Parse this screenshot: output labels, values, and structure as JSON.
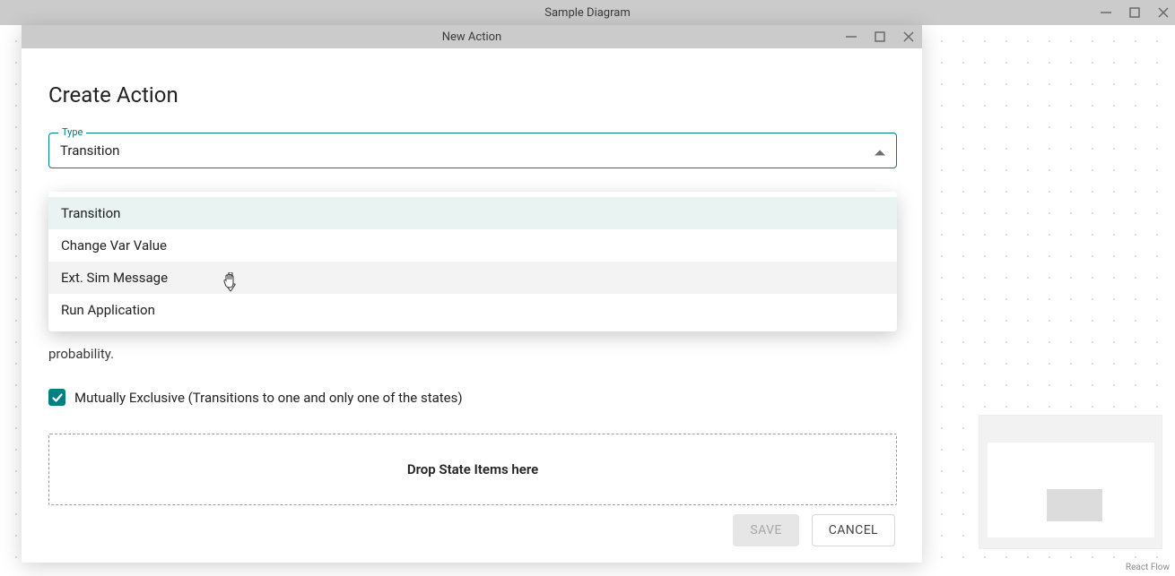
{
  "app": {
    "title": "Sample Diagram"
  },
  "dialog": {
    "title": "New Action",
    "heading": "Create Action",
    "type_field": {
      "label": "Type",
      "value": "Transition",
      "options": [
        "Transition",
        "Change Var Value",
        "Ext. Sim Message",
        "Run Application"
      ]
    },
    "instructions_tail": "probability.",
    "mutually_exclusive": {
      "checked": true,
      "label": "Mutually Exclusive (Transitions to one and only one of the states)"
    },
    "dropzone_text": "Drop State Items here",
    "buttons": {
      "save": "SAVE",
      "cancel": "CANCEL"
    }
  },
  "attribution": "React Flow",
  "colors": {
    "accent": "#008080"
  }
}
